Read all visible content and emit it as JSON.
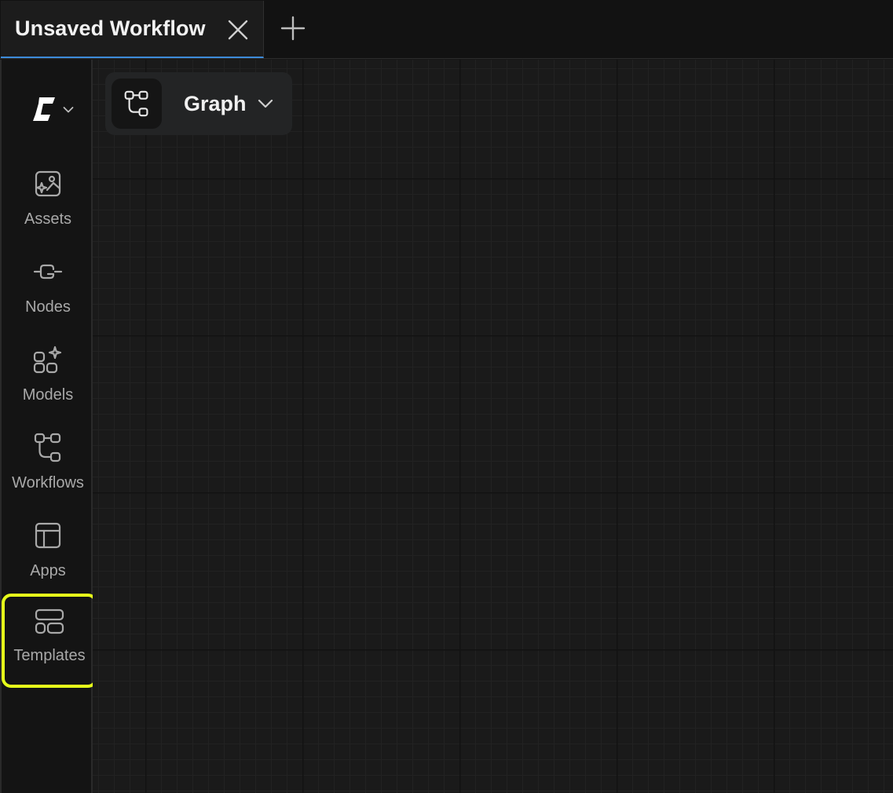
{
  "tabbar": {
    "active_tab": {
      "title": "Unsaved Workflow",
      "close_icon": "close-icon"
    },
    "new_tab_icon": "plus-icon"
  },
  "sidebar": {
    "logo_icon": "comfy-logo-icon",
    "logo_menu_icon": "chevron-down-icon",
    "items": [
      {
        "label": "Assets",
        "icon": "image-sparkle-icon"
      },
      {
        "label": "Nodes",
        "icon": "node-connector-icon"
      },
      {
        "label": "Models",
        "icon": "grid-sparkle-icon"
      },
      {
        "label": "Workflows",
        "icon": "workflow-icon"
      },
      {
        "label": "Apps",
        "icon": "layout-icon"
      },
      {
        "label": "Templates",
        "icon": "templates-icon",
        "highlighted": true
      }
    ]
  },
  "canvas": {
    "mode_selector": {
      "label": "Graph",
      "icon": "workflow-icon",
      "chevron": "chevron-down-icon"
    }
  },
  "colors": {
    "background": "#171717",
    "tab_underline": "#3d8bd9",
    "highlight": "#e6ff1a",
    "sidebar_label": "#a9a9a9"
  }
}
